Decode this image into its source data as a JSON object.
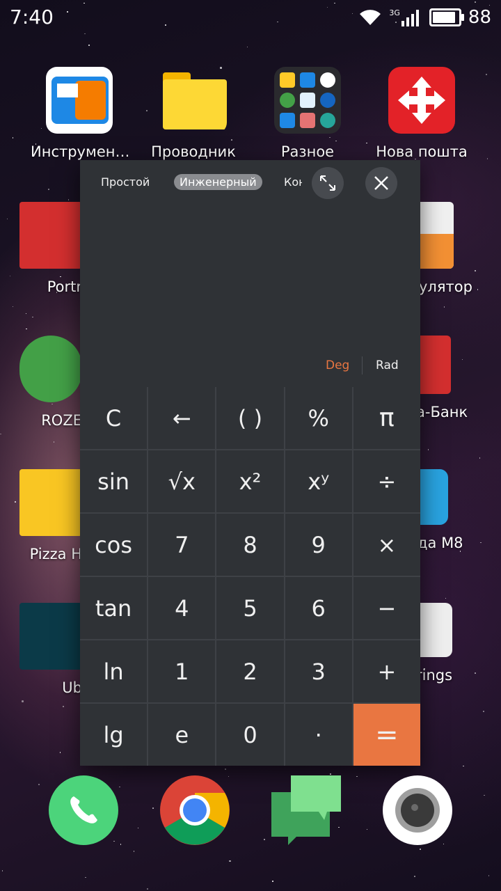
{
  "status_bar": {
    "time": "7:40",
    "network": "3G",
    "battery": "88",
    "battery_level": 0.88
  },
  "home_apps": [
    {
      "label": "Инструмен…"
    },
    {
      "label": "Проводник"
    },
    {
      "label": "Разное"
    },
    {
      "label": "Нова пошта"
    },
    {
      "label": "Portr"
    },
    {
      "label": "улятор"
    },
    {
      "label": "ROZE"
    },
    {
      "label": "а-Банк"
    },
    {
      "label": "Pizza H"
    },
    {
      "label": "да M8"
    },
    {
      "label": "Ub"
    },
    {
      "label": "rings"
    }
  ],
  "calculator": {
    "tabs": [
      "Простой",
      "Инженерный",
      "Кон"
    ],
    "active_tab": "Инженерный",
    "mode_deg": "Deg",
    "mode_rad": "Rad",
    "accent_color": "#e97641",
    "keys": [
      "C",
      "←",
      "( )",
      "%",
      "π",
      "sin",
      "√x",
      "x²",
      "xʸ",
      "÷",
      "cos",
      "7",
      "8",
      "9",
      "×",
      "tan",
      "4",
      "5",
      "6",
      "−",
      "ln",
      "1",
      "2",
      "3",
      "+",
      "lg",
      "e",
      "0",
      "·",
      "="
    ]
  },
  "dock": [
    "phone-icon",
    "chrome-icon",
    "messages-icon",
    "camera-icon"
  ]
}
